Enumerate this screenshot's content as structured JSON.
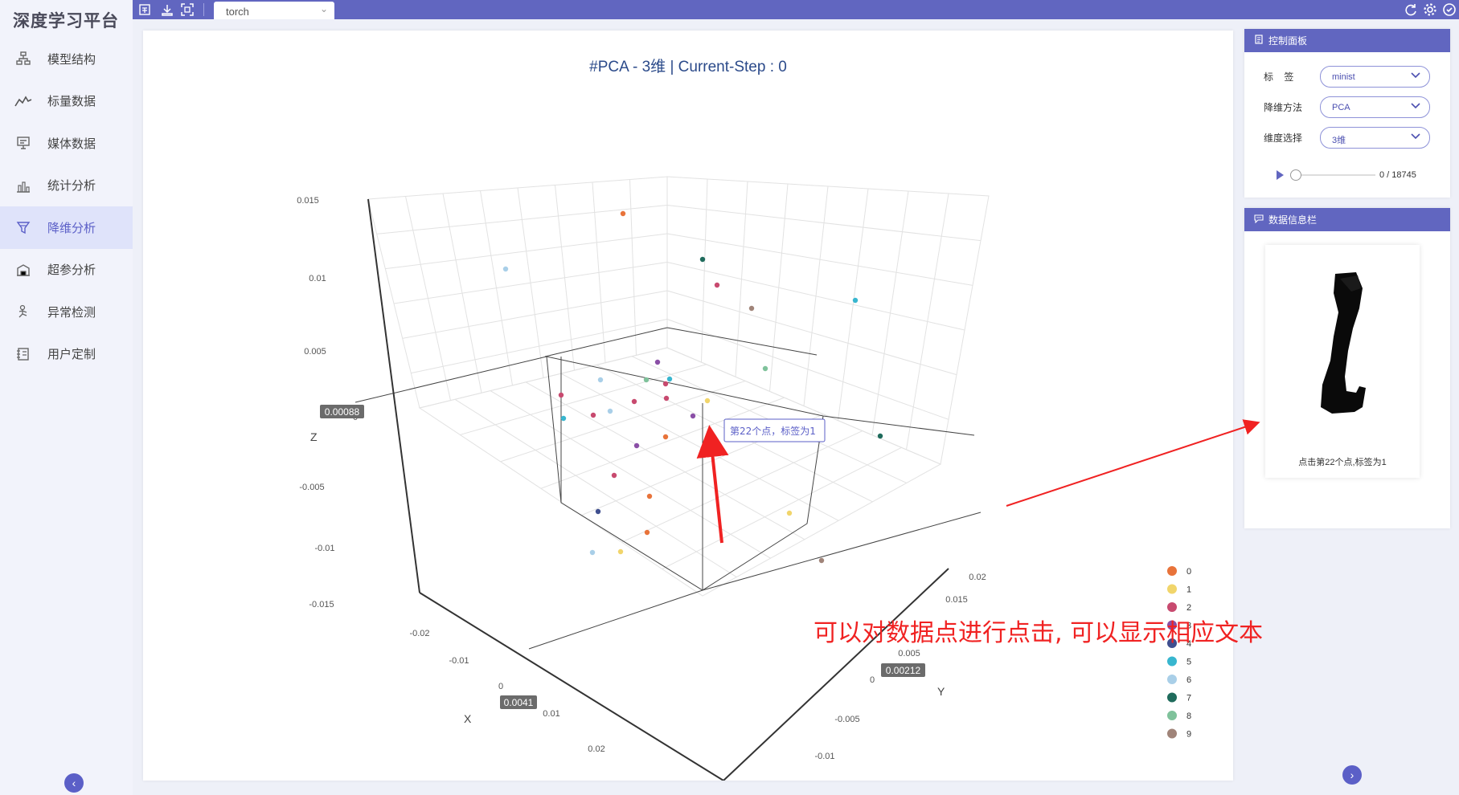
{
  "app": {
    "brand": "深度学习平台"
  },
  "sidebar": {
    "items": [
      {
        "label": "模型结构",
        "icon": "model-structure-icon"
      },
      {
        "label": "标量数据",
        "icon": "scalar-line-icon"
      },
      {
        "label": "媒体数据",
        "icon": "media-monitor-icon"
      },
      {
        "label": "统计分析",
        "icon": "stats-chart-icon"
      },
      {
        "label": "降维分析",
        "icon": "funnel-icon",
        "active": true
      },
      {
        "label": "超参分析",
        "icon": "building-icon"
      },
      {
        "label": "异常检测",
        "icon": "person-run-icon"
      },
      {
        "label": "用户定制",
        "icon": "custom-book-icon"
      }
    ]
  },
  "topbar": {
    "tab_label": "torch"
  },
  "chart_title": "#PCA - 3维 | Current-Step : 0",
  "control_panel": {
    "title": "控制面板",
    "label_field": {
      "label": "标    签",
      "value": "minist"
    },
    "method_field": {
      "label": "降维方法",
      "value": "PCA"
    },
    "dim_field": {
      "label": "维度选择",
      "value": "3维"
    },
    "step_readout": "0 / 18745",
    "step_value": 0
  },
  "info_panel": {
    "title": "数据信息栏",
    "caption": "点击第22个点,标签为1"
  },
  "tooltip": "第22个点，标签为1",
  "annotation": "可以对数据点进行点击, 可以显示相应文本",
  "axes": {
    "x_name": "X",
    "y_name": "Y",
    "z_name": "Z",
    "z_ticks": [
      "0.015",
      "0.01",
      "0.005",
      "0",
      "-0.005",
      "-0.01",
      "-0.015"
    ],
    "x_ticks": [
      "-0.02",
      "-0.01",
      "0",
      "0.01",
      "0.02"
    ],
    "y_ticks": [
      "0.02",
      "0.015",
      "0.005",
      "0",
      "-0.005",
      "-0.01"
    ],
    "z_pointer": "0.00088",
    "x_pointer": "0.0041",
    "y_pointer": "0.00212"
  },
  "legend": [
    {
      "label": "0",
      "color": "#e8733a"
    },
    {
      "label": "1",
      "color": "#f1d56b"
    },
    {
      "label": "2",
      "color": "#c84a6f"
    },
    {
      "label": "3",
      "color": "#8a4fa6"
    },
    {
      "label": "4",
      "color": "#3f4f8f"
    },
    {
      "label": "5",
      "color": "#38b6cf"
    },
    {
      "label": "6",
      "color": "#a9cfe8"
    },
    {
      "label": "7",
      "color": "#1f6b5c"
    },
    {
      "label": "8",
      "color": "#7fc29b"
    },
    {
      "label": "9",
      "color": "#a08479"
    }
  ]
}
